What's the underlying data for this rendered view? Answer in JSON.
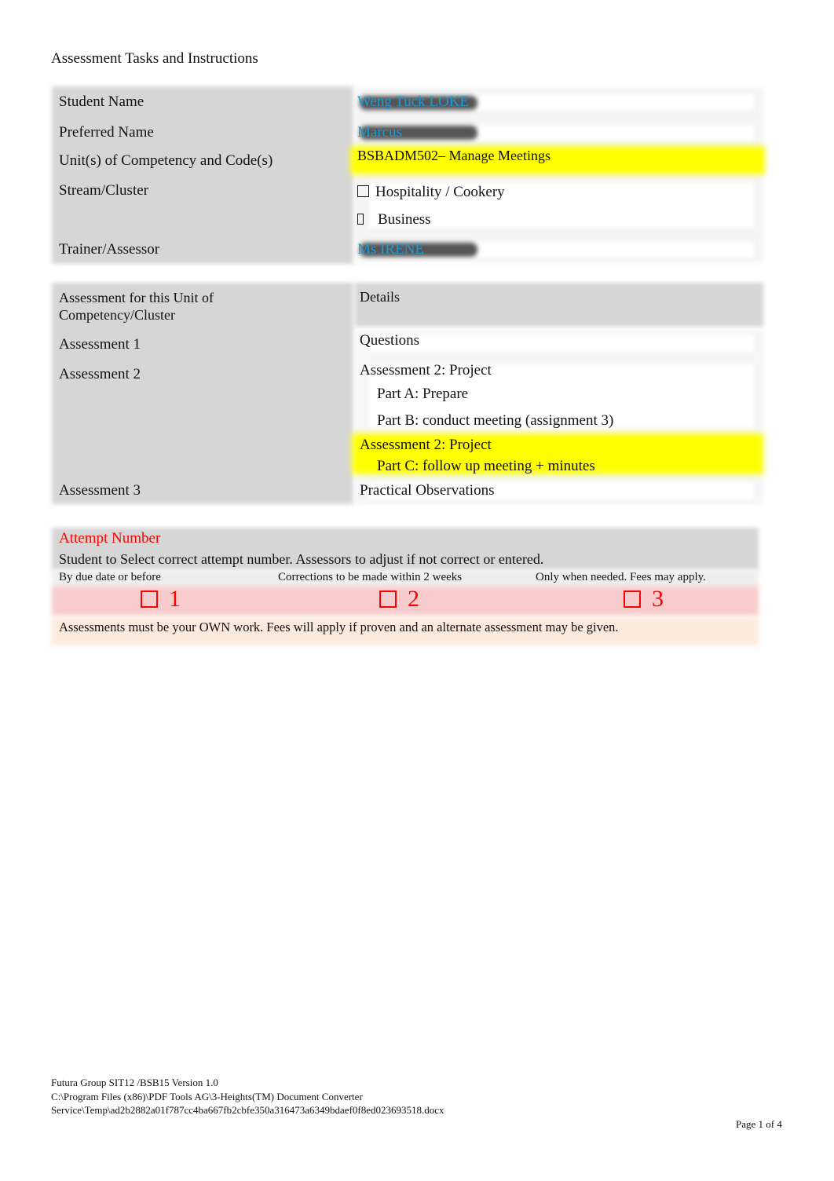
{
  "document": {
    "title": "Assessment Tasks and Instructions"
  },
  "student_table": {
    "rows": [
      {
        "label": "Student Name",
        "value": "Weng Tuck LOKE"
      },
      {
        "label": "Preferred Name",
        "value": "Marcus"
      },
      {
        "label": "Unit(s) of Competency and Code(s)",
        "value": "BSBADM502– Manage Meetings"
      },
      {
        "label": "Stream/Cluster",
        "options": [
          {
            "label": "Hospitality / Cookery",
            "checked": false
          },
          {
            "label": "Business",
            "checked": false
          }
        ]
      },
      {
        "label": "Trainer/Assessor",
        "value": "Ms IRENE"
      }
    ],
    "colors": {
      "value_text": "#1a9ad6",
      "highlight": "#ffff00"
    }
  },
  "assessment_table": {
    "header": {
      "left": "Assessment for this Unit of Competency/Cluster",
      "right": "Details"
    },
    "rows": [
      {
        "label": "Assessment 1",
        "details": [
          "Questions"
        ]
      },
      {
        "label": "Assessment 2",
        "details": [
          "Assessment 2: Project",
          "Part A: Prepare",
          "Part B: conduct meeting (assignment 3)"
        ],
        "highlighted_details": [
          "Assessment 2: Project",
          "Part C: follow up meeting + minutes"
        ]
      },
      {
        "label": "Assessment 3",
        "details": [
          "Practical Observations"
        ]
      }
    ]
  },
  "attempt": {
    "title": "Attempt Number",
    "instruction": "Student to Select correct attempt number. Assessors to adjust if not correct or entered.",
    "options": [
      {
        "caption": "By due date or before",
        "number": "1",
        "checked": false
      },
      {
        "caption": "Corrections to be made within 2 weeks",
        "number": "2",
        "checked": false
      },
      {
        "caption": "Only when needed. Fees may apply.",
        "number": "3",
        "checked": false
      }
    ],
    "note": "Assessments must be your OWN work. Fees will apply if proven and an alternate assessment may be given.",
    "colors": {
      "title": "#ff0000",
      "row_fill": "#f8cccc"
    }
  },
  "footer": {
    "line1": "Futura Group SIT12 /BSB15 Version 1.0",
    "line2": "C:\\Program Files (x86)\\PDF Tools AG\\3-Heights(TM) Document Converter",
    "line3": "Service\\Temp\\ad2b2882a01f787cc4ba667fb2cbfe350a316473a6349bdaef0f8ed023693518.docx",
    "page": "Page 1 of 4"
  }
}
